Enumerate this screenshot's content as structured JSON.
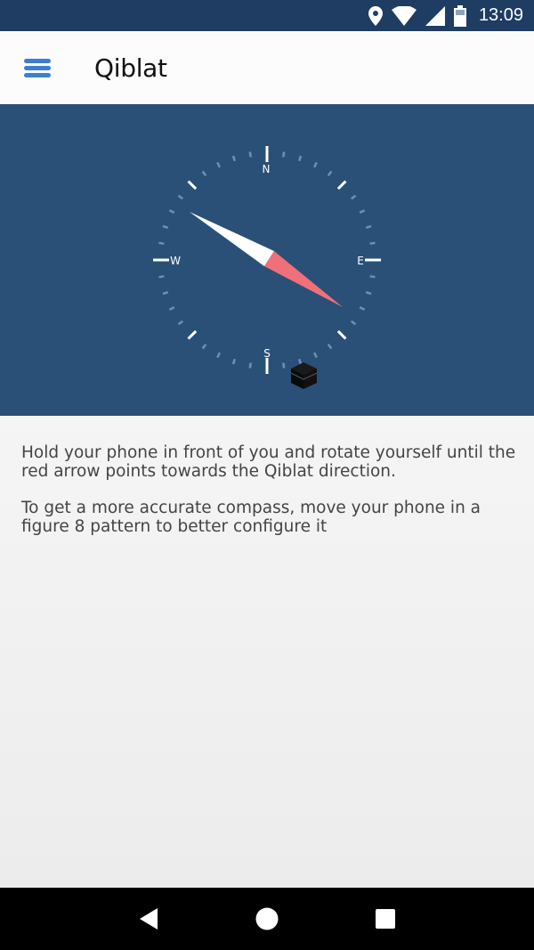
{
  "status_bar": {
    "time": "13:09",
    "icons": [
      "location-icon",
      "wifi-icon",
      "cellular-signal-icon",
      "battery-icon"
    ]
  },
  "app_bar": {
    "title": "Qiblat",
    "menu_icon": "hamburger-menu-icon"
  },
  "compass": {
    "labels": {
      "north": "N",
      "east": "E",
      "south": "S",
      "west": "W"
    },
    "needle_color_pointer": "#f0707a",
    "needle_color_tail": "#ffffff",
    "kaaba_icon": "kaaba-icon"
  },
  "instructions": {
    "paragraph1": "Hold your phone in front of you and rotate yourself until the red arrow points towards the Qiblat direction.",
    "paragraph2": "To get a more accurate compass, move your phone in a figure 8 pattern to better configure it"
  },
  "nav_bar": {
    "icons": [
      "back-icon",
      "home-icon",
      "recents-icon"
    ]
  },
  "colors": {
    "status_bar": "#1f3d63",
    "compass_panel": "#2a5077",
    "menu_accent": "#3d7fcf"
  }
}
